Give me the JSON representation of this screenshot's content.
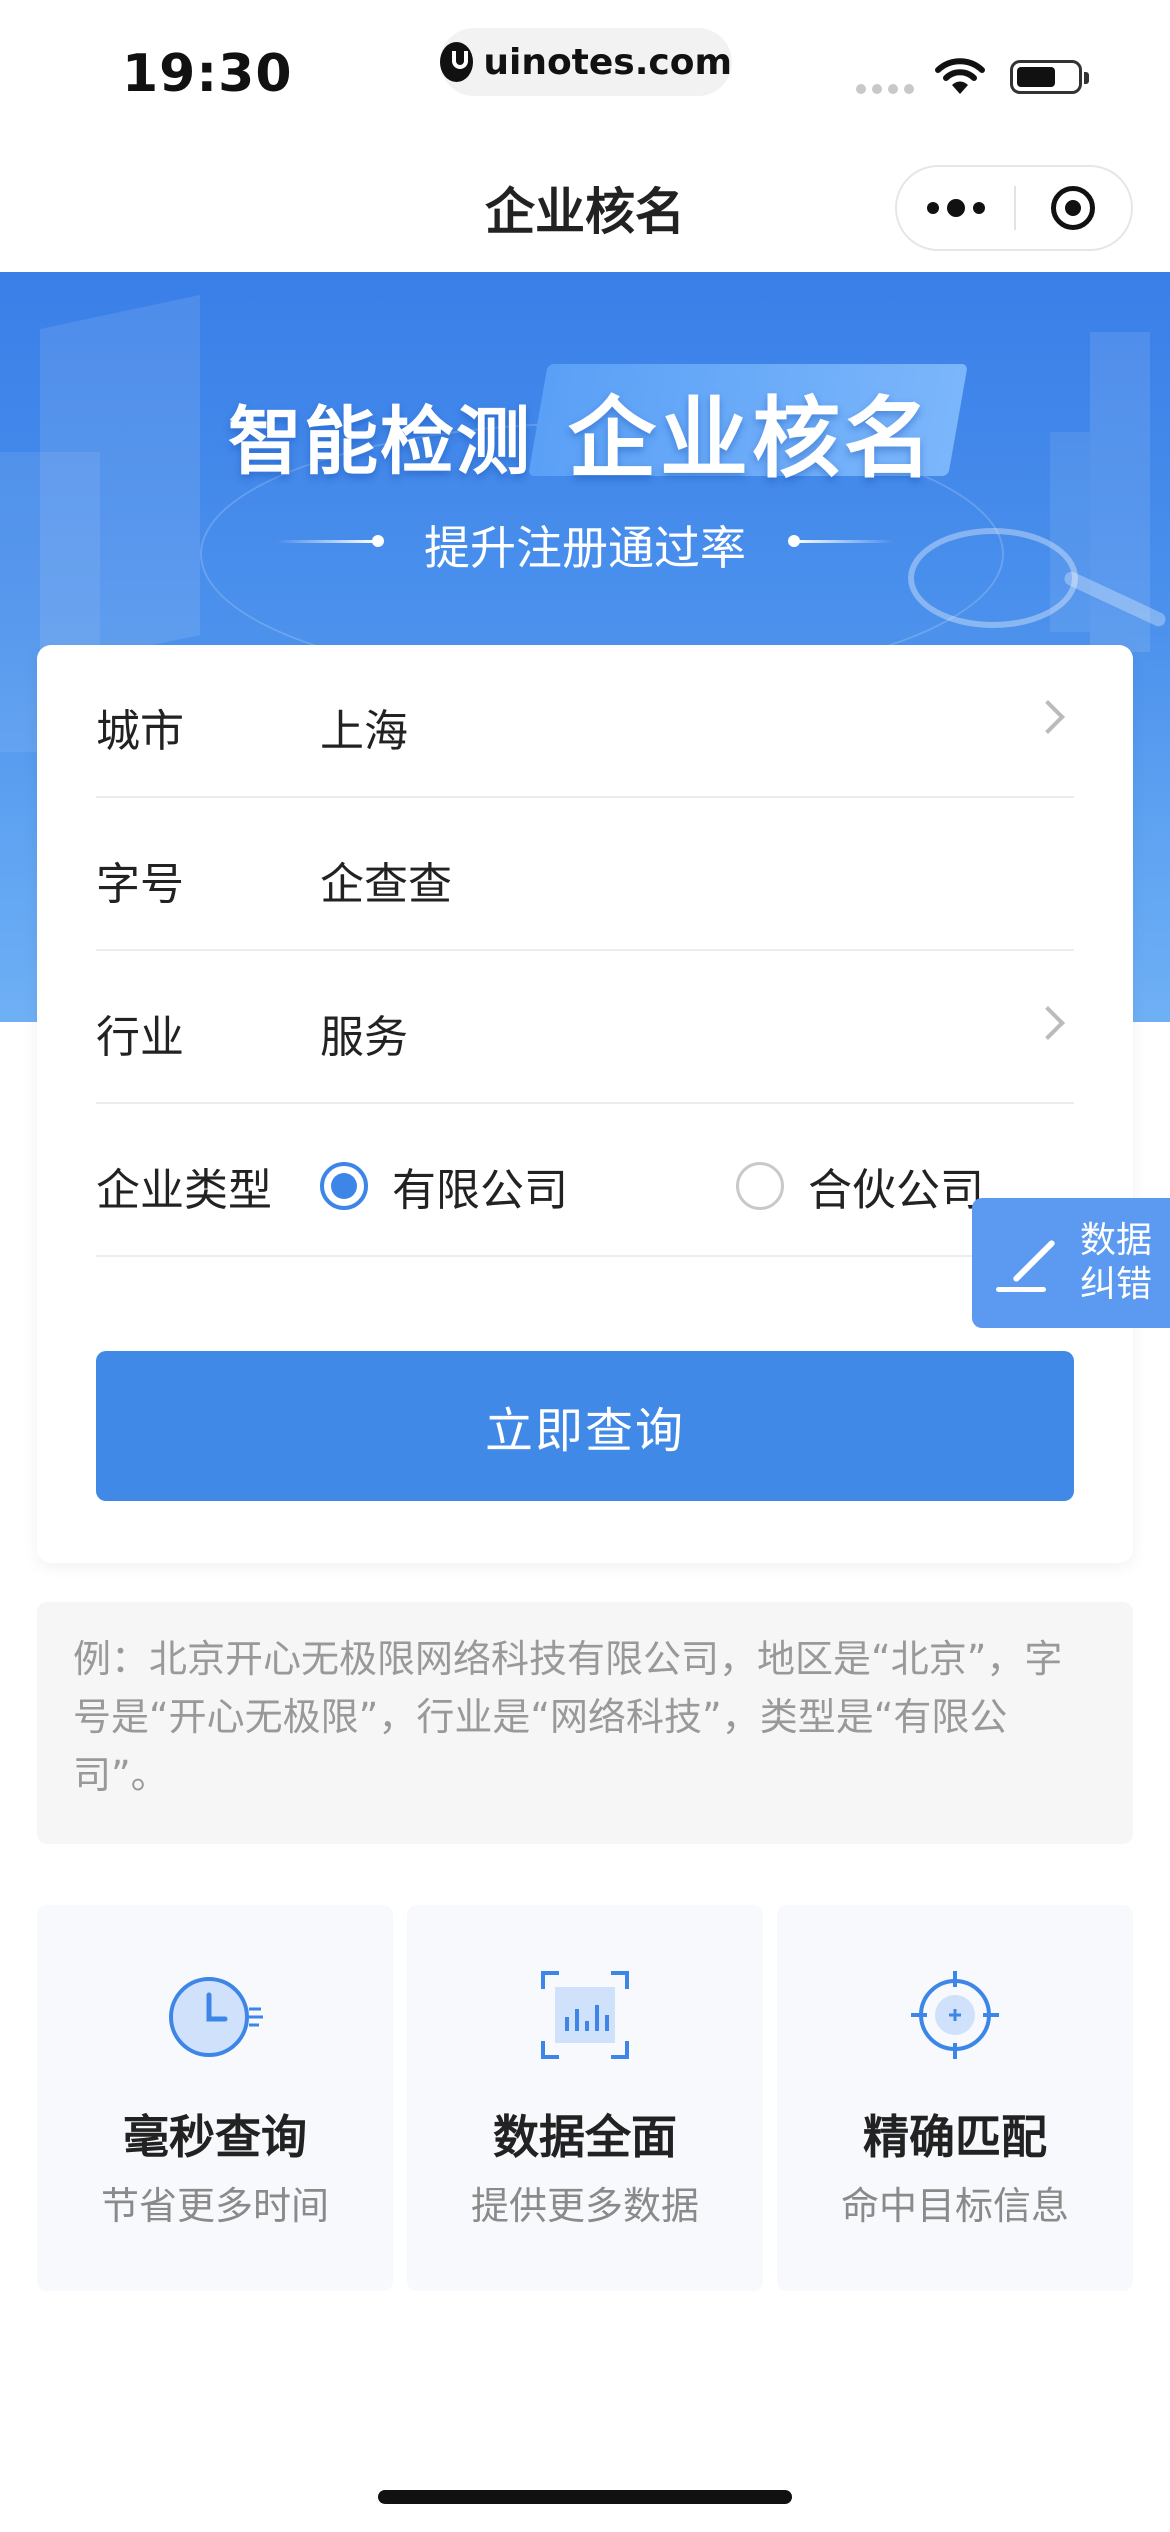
{
  "status_bar": {
    "time": "19:30",
    "url": "uinotes.com"
  },
  "nav": {
    "title": "企业核名"
  },
  "banner": {
    "headline_left": "智能检测",
    "headline_right": "企业核名",
    "subtitle": "提升注册通过率"
  },
  "form": {
    "city_label": "城市",
    "city_value": "上海",
    "name_label": "字号",
    "name_value": "企查查",
    "industry_label": "行业",
    "industry_value": "服务",
    "type_label": "企业类型",
    "type_options": [
      "有限公司",
      "合伙公司"
    ],
    "type_selected": "有限公司",
    "submit_label": "立即查询"
  },
  "fab": {
    "line1": "数据",
    "line2": "纠错"
  },
  "tip": {
    "text": "例：北京开心无极限网络科技有限公司，地区是“北京”，字号是“开心无极限”，行业是“网络科技”，类型是“有限公司”。"
  },
  "features": [
    {
      "icon": "clock-icon",
      "title": "毫秒查询",
      "subtitle": "节省更多时间"
    },
    {
      "icon": "chart-scan-icon",
      "title": "数据全面",
      "subtitle": "提供更多数据"
    },
    {
      "icon": "target-icon",
      "title": "精确匹配",
      "subtitle": "命中目标信息"
    }
  ],
  "colors": {
    "primary": "#4089e6",
    "banner_top": "#3a7fe8",
    "fab": "#5b9af0"
  }
}
